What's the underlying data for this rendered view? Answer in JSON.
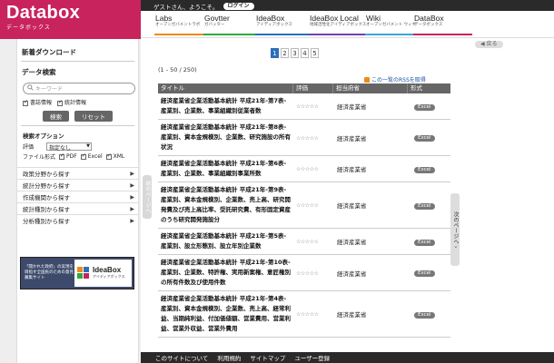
{
  "brand": {
    "name": "Databox",
    "kana": "データボックス",
    "color": "#c8235c"
  },
  "topbar": {
    "greeting": "ゲストさん、ようこそ。",
    "login": "ログイン"
  },
  "nav": [
    {
      "title": "Labs",
      "sub": "オープンガバメントラボ",
      "color": "#f08a1a"
    },
    {
      "title": "Govtter",
      "sub": "ガバッター",
      "color": "#2eaa3c"
    },
    {
      "title": "IdeaBox",
      "sub": "アイディアボックス",
      "color": "#2b6fb8"
    },
    {
      "title": "IdeaBox Local",
      "sub": "地域活性化アイディアボックス",
      "color": "#7a3fa5"
    },
    {
      "title": "Wiki",
      "sub": "オープンガバメント ウィキ",
      "color": "#3aa7d6"
    },
    {
      "title": "DataBox",
      "sub": "データボックス",
      "color": "#c8235c"
    }
  ],
  "sidebar": {
    "new_downloads": "新着ダウンロード",
    "search_title": "データ検索",
    "search_placeholder": "キーワード",
    "chk_docs": "書誌情報",
    "chk_stats": "統計情報",
    "search_btn": "検索",
    "reset_btn": "リセット",
    "opt_title": "検索オプション",
    "rating_label": "評価",
    "rating_value": "指定なし",
    "format_label": "ファイル形式",
    "formats": [
      "PDF",
      "Excel",
      "XML"
    ],
    "browse": [
      "政策分野から探す",
      "統計分野から探す",
      "作成機関から探す",
      "統計種別から探す",
      "分析種別から探す"
    ],
    "banner_text": "「開かれた政府」の実現を目指す全国民のための意見募集サイト",
    "banner_title": "IdeaBox",
    "banner_sub": "アイディアボックス"
  },
  "main": {
    "back": "戻る",
    "pages": [
      "1",
      "2",
      "3",
      "4",
      "5"
    ],
    "count": "(1 - 50 / 250)",
    "rss": "この一覧のRSSを取得",
    "prev_tab": "前のページへ",
    "next_tab": "次のページへ",
    "headers": [
      "タイトル",
      "評価",
      "担当府省",
      "形式"
    ],
    "rows": [
      {
        "title": "経済産業省企業活動基本統計 平成21年-第7表-産業別、企業数、事業組織別従業者数",
        "ministry": "経済産業省",
        "format": "Excel"
      },
      {
        "title": "経済産業省企業活動基本統計 平成21年-第8表-産業別、資本金規模別、企業数、研究施設の所有状況",
        "ministry": "経済産業省",
        "format": "Excel"
      },
      {
        "title": "経済産業省企業活動基本統計 平成21年-第6表-産業別、企業数、事業組織別事業所数",
        "ministry": "経済産業省",
        "format": "Excel"
      },
      {
        "title": "経済産業省企業活動基本統計 平成21年-第9表-産業別、資本金規模別、企業数、売上高、研究開発費及び売上高比率、受託研究費、有形固定資産のうち研究開発施設分",
        "ministry": "経済産業省",
        "format": "Excel"
      },
      {
        "title": "経済産業省企業活動基本統計 平成21年-第5表-産業別、設立形態別、設立年別企業数",
        "ministry": "経済産業省",
        "format": "Excel"
      },
      {
        "title": "経済産業省企業活動基本統計 平成21年-第10表-産業別、企業数、特許権、実用新案権、意匠権別の所有件数及び使用件数",
        "ministry": "経済産業省",
        "format": "Excel"
      },
      {
        "title": "経済産業省企業活動基本統計 平成21年-第4表-産業別、資本金規模別、企業数、売上高、経常利益、当期純利益、付加価値額、営業費用、営業利益、営業外収益、営業外費用",
        "ministry": "経済産業省",
        "format": "Excel"
      }
    ]
  },
  "footer": [
    "このサイトについて",
    "利用規約",
    "サイトマップ",
    "ユーザー登録"
  ]
}
